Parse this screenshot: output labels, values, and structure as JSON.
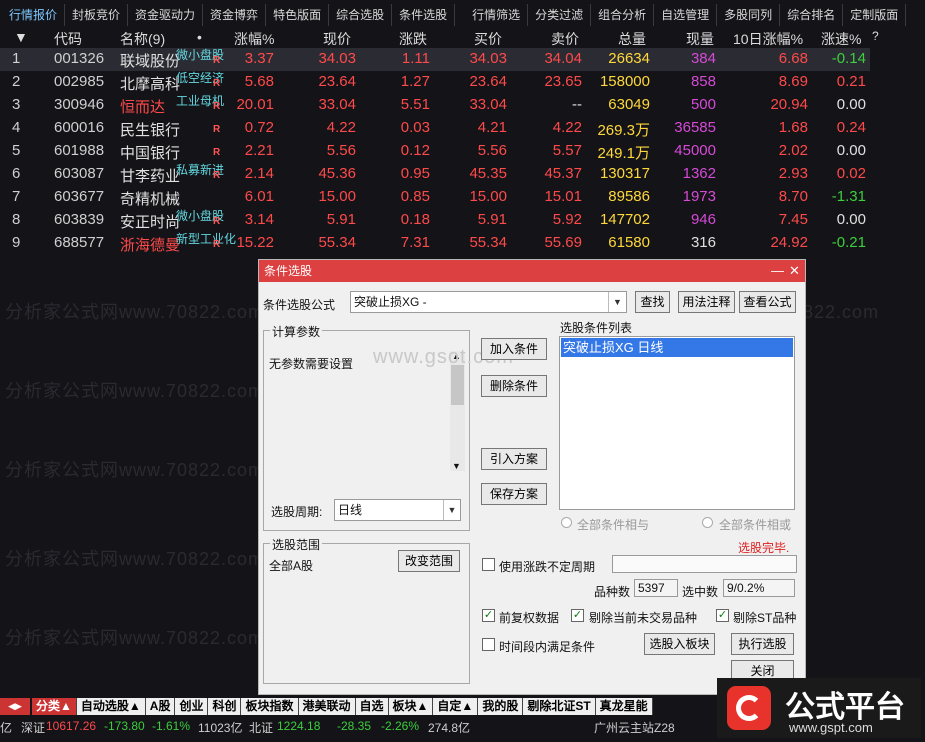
{
  "menu_tabs": [
    "行情报价",
    "封板竞价",
    "资金驱动力",
    "资金博弈",
    "特色版面",
    "综合选股",
    "条件选股",
    "行情筛选",
    "分类过滤",
    "组合分析",
    "自选管理",
    "多股同列",
    "综合排名",
    "定制版面"
  ],
  "headers": {
    "code": "代码",
    "name": "名称(9)",
    "dot": "•",
    "pct": "涨幅%",
    "price": "现价",
    "chg": "涨跌",
    "bid": "买价",
    "ask": "卖价",
    "vol": "总量",
    "cur": "现量",
    "pct10": "10日涨幅%",
    "speed": "涨速%",
    "q": "?"
  },
  "rows": [
    {
      "idx": "1",
      "code": "001326",
      "name": "联域股份",
      "tag": "微小盘股",
      "r": "R",
      "pct": "3.37",
      "price": "34.03",
      "chg": "1.11",
      "bid": "34.03",
      "ask": "34.04",
      "vol": "26634",
      "cur": "384",
      "pct10": "6.68",
      "speed": "-0.14"
    },
    {
      "idx": "2",
      "code": "002985",
      "name": "北摩高科",
      "tag": "低空经济",
      "r": "R",
      "pct": "5.68",
      "price": "23.64",
      "chg": "1.27",
      "bid": "23.64",
      "ask": "23.65",
      "vol": "158000",
      "cur": "858",
      "pct10": "8.69",
      "speed": "0.21"
    },
    {
      "idx": "3",
      "code": "300946",
      "name": "恒而达",
      "tag": "工业母机",
      "r": "R",
      "pct": "20.01",
      "price": "33.04",
      "chg": "5.51",
      "bid": "33.04",
      "ask": "--",
      "vol": "63049",
      "cur": "500",
      "pct10": "20.94",
      "speed": "0.00"
    },
    {
      "idx": "4",
      "code": "600016",
      "name": "民生银行",
      "tag": "",
      "r": "R",
      "pct": "0.72",
      "price": "4.22",
      "chg": "0.03",
      "bid": "4.21",
      "ask": "4.22",
      "vol": "269.3万",
      "cur": "36585",
      "pct10": "1.68",
      "speed": "0.24"
    },
    {
      "idx": "5",
      "code": "601988",
      "name": "中国银行",
      "tag": "",
      "r": "R",
      "pct": "2.21",
      "price": "5.56",
      "chg": "0.12",
      "bid": "5.56",
      "ask": "5.57",
      "vol": "249.1万",
      "cur": "45000",
      "pct10": "2.02",
      "speed": "0.00"
    },
    {
      "idx": "6",
      "code": "603087",
      "name": "甘李药业",
      "tag": "私募新进",
      "r": "R",
      "pct": "2.14",
      "price": "45.36",
      "chg": "0.95",
      "bid": "45.35",
      "ask": "45.37",
      "vol": "130317",
      "cur": "1362",
      "pct10": "2.93",
      "speed": "0.02"
    },
    {
      "idx": "7",
      "code": "603677",
      "name": "奇精机械",
      "tag": "",
      "r": "",
      "pct": "6.01",
      "price": "15.00",
      "chg": "0.85",
      "bid": "15.00",
      "ask": "15.01",
      "vol": "89586",
      "cur": "1973",
      "pct10": "8.70",
      "speed": "-1.31"
    },
    {
      "idx": "8",
      "code": "603839",
      "name": "安正时尚",
      "tag": "微小盘股",
      "r": "R",
      "pct": "3.14",
      "price": "5.91",
      "chg": "0.18",
      "bid": "5.91",
      "ask": "5.92",
      "vol": "147702",
      "cur": "946",
      "pct10": "7.45",
      "speed": "0.00"
    },
    {
      "idx": "9",
      "code": "688577",
      "name": "浙海德曼",
      "tag": "新型工业化",
      "r": "R",
      "pct": "15.22",
      "price": "55.34",
      "chg": "7.31",
      "bid": "55.34",
      "ask": "55.69",
      "vol": "61580",
      "cur": "316",
      "pct10": "24.92",
      "speed": "-0.21"
    }
  ],
  "watermarks": [
    "分析家公式网www.70822.com",
    "分析家公式网www.70822.com",
    "分析家公式网www.70822.com",
    "分析家公式网www.70822.com",
    "分析家公式网www.70822.com",
    "分析家公式网www.70822.com"
  ],
  "dialog": {
    "title": "条件选股",
    "formula_label": "条件选股公式",
    "formula_value": "突破止损XG  -",
    "btn_find": "查找",
    "btn_usage": "用法注释",
    "btn_view": "查看公式",
    "params_title": "计算参数",
    "params_text": "无参数需要设置",
    "site_watermark": "www.gsot.com",
    "period_label": "选股周期:",
    "period_value": "日线",
    "btn_add": "加入条件",
    "btn_del": "删除条件",
    "btn_import": "引入方案",
    "btn_save": "保存方案",
    "list_title": "选股条件列表",
    "list_item": "突破止损XG  日线",
    "radio_and": "全部条件相与",
    "radio_or": "全部条件相或",
    "done": "选股完毕.",
    "range_title": "选股范围",
    "range_value": "全部A股",
    "btn_range": "改变范围",
    "chk_period": "使用涨跌不定周期",
    "count_label": "品种数",
    "count_value": "5397",
    "sel_label": "选中数",
    "sel_value": "9/0.2%",
    "chk_fq": "前复权数据",
    "chk_untraded": "剔除当前未交易品种",
    "chk_st": "剔除ST品种",
    "chk_time": "时间段内满足条件",
    "btn_block": "选股入板块",
    "btn_exec": "执行选股",
    "btn_close": "关闭"
  },
  "bottom_tabs": [
    "分类▲",
    "自动选股▲",
    "A股",
    "创业",
    "科创",
    "板块指数",
    "港美联动",
    "自选",
    "板块▲",
    "自定▲",
    "我的股",
    "剔除北证ST",
    "真龙星能"
  ],
  "status": {
    "a": "亿",
    "sz_label": "深证",
    "sz_val": "10617.26",
    "sz_chg": "-173.80",
    "sz_pct": "-1.61%",
    "sz_amt": "11023亿",
    "bz_label": "北证",
    "bz_val": "1224.18",
    "bz_chg": "-28.35",
    "bz_pct": "-2.26%",
    "bz_amt": "274.8亿",
    "station": "广州云主站Z28"
  },
  "logo": {
    "text": "公式平台",
    "url": "www.gspt.com",
    "color": "#e8322c"
  }
}
